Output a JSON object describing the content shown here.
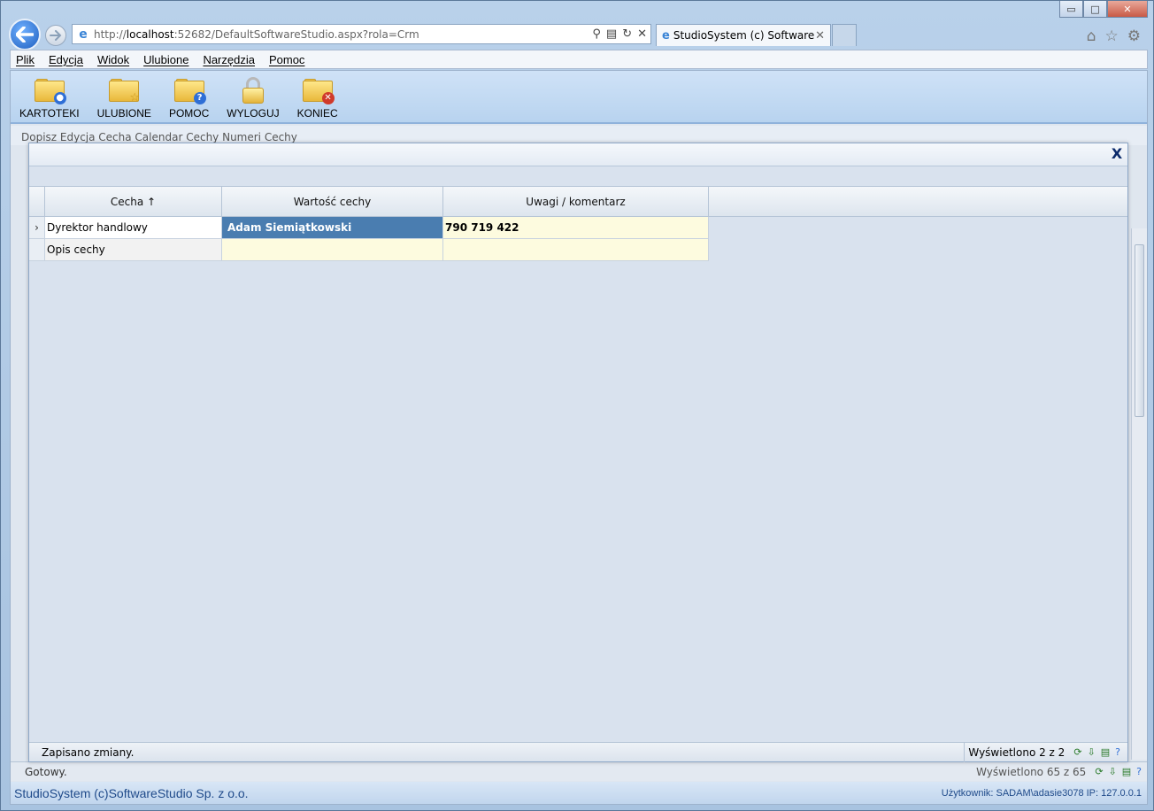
{
  "browser": {
    "url_prefix": "http://",
    "url_host": "localhost",
    "url_rest": ":52682/DefaultSoftwareStudio.aspx?rola=Crm",
    "tab_title": "StudioSystem (c) SoftwareS...",
    "tab_close": "✕",
    "window_buttons": {
      "minimize": "▭",
      "maximize": "□",
      "close": "✕"
    },
    "icons": [
      "home-icon",
      "favorites-star-icon",
      "settings-gear-icon"
    ]
  },
  "menu": [
    "Plik",
    "Edycja",
    "Widok",
    "Ulubione",
    "Narzędzia",
    "Pomoc"
  ],
  "toolbar": {
    "buttons": [
      {
        "label": "KARTOTEKI",
        "icon": "folder-user-icon",
        "badge": "●",
        "badge_color": "#2f6fd6"
      },
      {
        "label": "ULUBIONE",
        "icon": "folder-star-icon",
        "badge": "☆",
        "badge_color": "#e2b52f"
      },
      {
        "label": "POMOC",
        "icon": "folder-help-icon",
        "badge": "?",
        "badge_color": "#2f6fd6"
      },
      {
        "label": "WYLOGUJ",
        "icon": "lock-icon"
      },
      {
        "label": "KONIEC",
        "icon": "folder-close-icon",
        "badge": "✕",
        "badge_color": "#d03a2a"
      }
    ]
  },
  "subbar_text": "Dopisz  Edycja  Cecha Calendar  Cechy Numeri  Cechy",
  "modal": {
    "close": "X",
    "columns": [
      "Cecha",
      "Wartość cechy",
      "Uwagi / komentarz"
    ],
    "sort_indicator": "↑",
    "rows": [
      {
        "marker": "›",
        "cecha": "Dyrektor handlowy",
        "wartosc": "Adam Siemiątkowski",
        "uwagi": "790 719 422"
      },
      {
        "marker": "",
        "cecha": "Opis cechy",
        "wartosc": "",
        "uwagi": ""
      }
    ],
    "status": "Zapisano zmiany.",
    "count": "Wyświetlono 2 z 2"
  },
  "status": {
    "text": "Gotowy.",
    "count": "Wyświetlono 65 z 65"
  },
  "footer": {
    "brand": "StudioSystem (c)SoftwareStudio Sp. z o.o.",
    "user": "Użytkownik: SADAM\\adasie3078 IP: 127.0.0.1"
  },
  "colors": {
    "selected_cell": "#4a7db0",
    "editable_cell": "#fdfbdf",
    "brand_text": "#1f4a8a"
  }
}
